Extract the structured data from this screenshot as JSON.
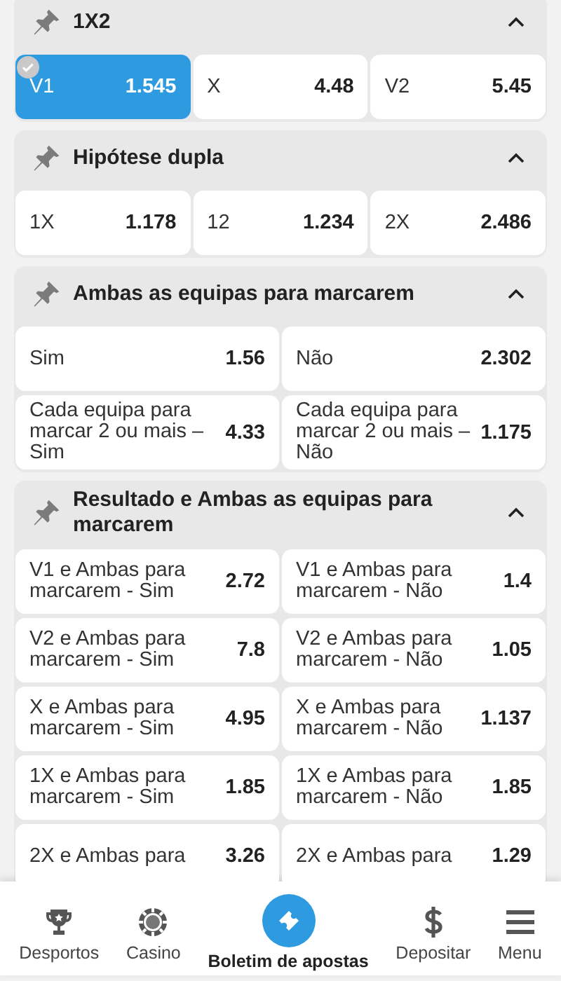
{
  "sections": [
    {
      "title": "1X2",
      "pinned": true,
      "expanded": true,
      "rows": [
        [
          {
            "label": "V1",
            "odds": "1.545",
            "selected": true
          },
          {
            "label": "X",
            "odds": "4.48",
            "selected": false
          },
          {
            "label": "V2",
            "odds": "5.45",
            "selected": false
          }
        ]
      ]
    },
    {
      "title": "Hipótese dupla",
      "pinned": true,
      "expanded": true,
      "rows": [
        [
          {
            "label": "1X",
            "odds": "1.178",
            "selected": false
          },
          {
            "label": "12",
            "odds": "1.234",
            "selected": false
          },
          {
            "label": "2X",
            "odds": "2.486",
            "selected": false
          }
        ]
      ]
    },
    {
      "title": "Ambas as equipas para marcarem",
      "pinned": true,
      "expanded": true,
      "rows": [
        [
          {
            "label": "Sim",
            "odds": "1.56",
            "selected": false
          },
          {
            "label": "Não",
            "odds": "2.302",
            "selected": false
          }
        ],
        [
          {
            "label": "Cada equipa para marcar 2 ou mais – Sim",
            "odds": "4.33",
            "selected": false
          },
          {
            "label": "Cada equipa para marcar 2 ou mais – Não",
            "odds": "1.175",
            "selected": false
          }
        ]
      ]
    },
    {
      "title": "Resultado e Ambas as equipas para marcarem",
      "pinned": true,
      "expanded": true,
      "rows": [
        [
          {
            "label": "V1 e Ambas para marcarem - Sim",
            "odds": "2.72",
            "selected": false
          },
          {
            "label": "V1 e Ambas para marcarem - Não",
            "odds": "1.4",
            "selected": false
          }
        ],
        [
          {
            "label": "V2 e Ambas para marcarem - Sim",
            "odds": "7.8",
            "selected": false
          },
          {
            "label": "V2 e Ambas para marcarem - Não",
            "odds": "1.05",
            "selected": false
          }
        ],
        [
          {
            "label": "X e Ambas para marcarem - Sim",
            "odds": "4.95",
            "selected": false
          },
          {
            "label": "X e Ambas para marcarem - Não",
            "odds": "1.137",
            "selected": false
          }
        ],
        [
          {
            "label": "1X e Ambas para marcarem - Sim",
            "odds": "1.85",
            "selected": false
          },
          {
            "label": "1X e Ambas para marcarem - Não",
            "odds": "1.85",
            "selected": false
          }
        ],
        [
          {
            "label": "2X e Ambas para",
            "odds": "3.26",
            "selected": false
          },
          {
            "label": "2X e Ambas para",
            "odds": "1.29",
            "selected": false
          }
        ]
      ]
    }
  ],
  "nav": [
    {
      "label": "Desportos",
      "kind": "trophy"
    },
    {
      "label": "Casino",
      "kind": "chip"
    },
    {
      "label": "Boletim de apostas",
      "kind": "ticket"
    },
    {
      "label": "Depositar",
      "kind": "dollar"
    },
    {
      "label": "Menu",
      "kind": "menu"
    }
  ]
}
